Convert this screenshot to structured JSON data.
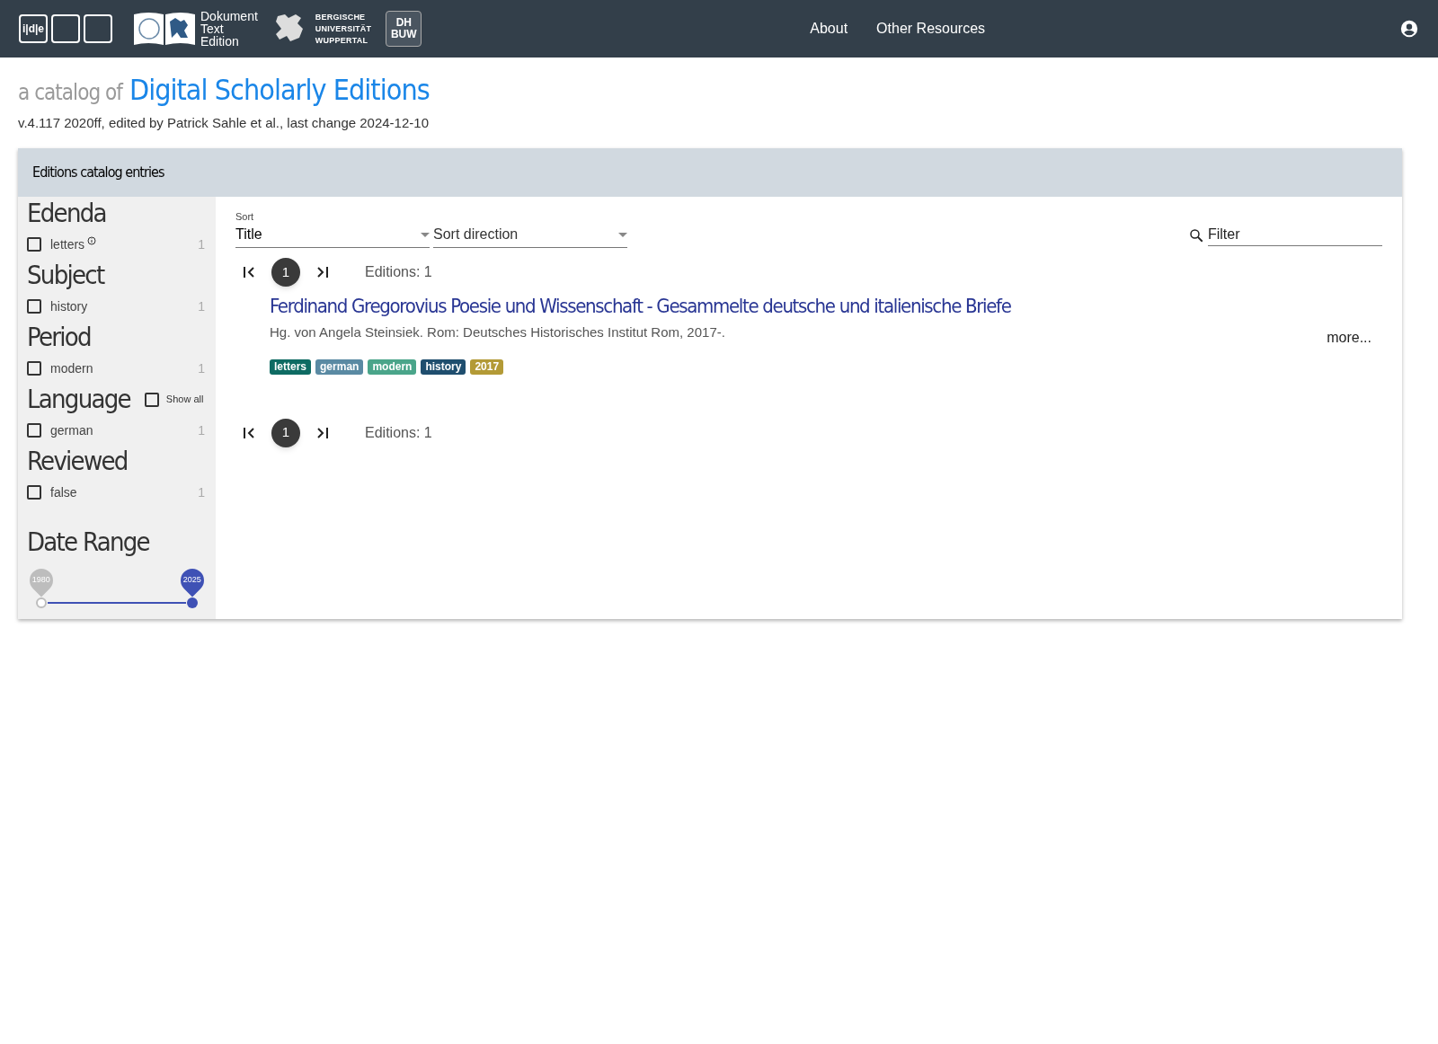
{
  "header": {
    "ide_logo": "i|d|e",
    "dte_logo": [
      "Dokument",
      "Text",
      "Edition"
    ],
    "buw_logo": [
      "BERGISCHE",
      "UNIVERSITÄT",
      "WUPPERTAL"
    ],
    "dh_logo": [
      "DH",
      "BUW"
    ],
    "nav": [
      "About",
      "Other Resources"
    ]
  },
  "heading": {
    "prefix": "a catalog of",
    "title": "Digital Scholarly Editions",
    "subtitle": "v.4.117 2020ff, edited by Patrick Sahle et al., last change 2024-12-10"
  },
  "panel": {
    "title": "Editions catalog entries"
  },
  "facets": [
    {
      "title": "Edenda",
      "options": [
        {
          "label": "letters",
          "count": "1",
          "checked": false,
          "info": true
        }
      ]
    },
    {
      "title": "Subject",
      "options": [
        {
          "label": "history",
          "count": "1",
          "checked": false,
          "info": false
        }
      ]
    },
    {
      "title": "Period",
      "options": [
        {
          "label": "modern",
          "count": "1",
          "checked": false,
          "info": false
        }
      ]
    },
    {
      "title": "Language",
      "show_all": {
        "label": "Show all",
        "checked": false
      },
      "options": [
        {
          "label": "german",
          "count": "1",
          "checked": false,
          "info": false
        }
      ]
    },
    {
      "title": "Reviewed",
      "options": [
        {
          "label": "false",
          "count": "1",
          "checked": false,
          "info": false
        }
      ]
    }
  ],
  "date_range": {
    "title": "Date Range",
    "low": {
      "label": "1980",
      "level": 0
    },
    "high": {
      "label": "2025",
      "level": 1
    }
  },
  "sort": {
    "label": "Sort",
    "value": "Title",
    "direction_placeholder": "Sort direction"
  },
  "filter": {
    "placeholder": "Filter"
  },
  "pagination_top": {
    "pages": [
      {
        "label": "1",
        "selected": true
      }
    ],
    "count": "Editions: 1"
  },
  "entries": [
    {
      "title": "Ferdinand Gregorovius Poesie und Wissenschaft - Gesammelte deutsche und italienische Briefe",
      "citation": "Hg. von Angela Steinsiek. Rom: Deutsches Historisches Institut Rom, 2017-.",
      "more": "more...",
      "tags": [
        {
          "label": "letters",
          "color": "#0e6b63"
        },
        {
          "label": "german",
          "color": "#5a8aa3"
        },
        {
          "label": "modern",
          "color": "#4aa58a"
        },
        {
          "label": "history",
          "color": "#1f4e6e"
        },
        {
          "label": "2017",
          "color": "#b39a36"
        }
      ]
    }
  ],
  "pagination_bottom": {
    "pages": [
      {
        "label": "1",
        "selected": true
      }
    ],
    "count": "Editions: 1"
  }
}
